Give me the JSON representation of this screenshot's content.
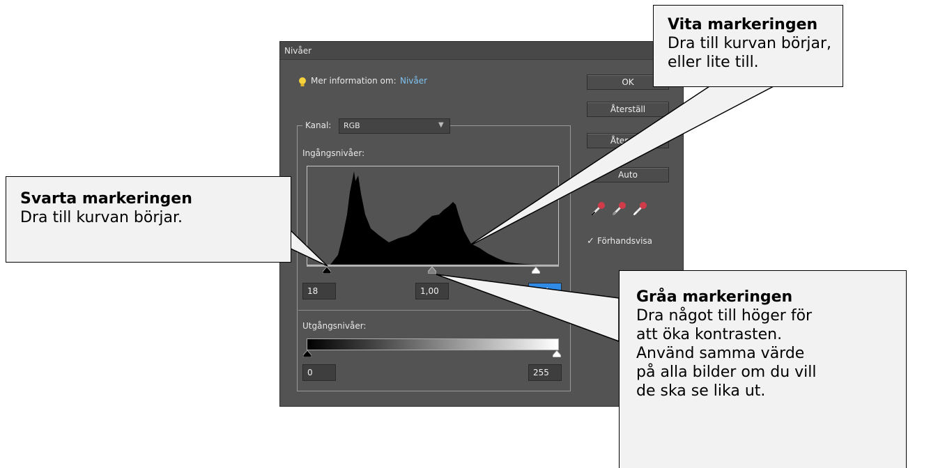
{
  "dialog": {
    "title": "Nivåer",
    "info_label": "Mer information om:",
    "info_link": "Nivåer",
    "channel_label": "Kanal:",
    "channel_value": "RGB",
    "input_levels_label": "Ingångsnivåer:",
    "input_black": "18",
    "input_gamma": "1,00",
    "input_white": "234",
    "output_levels_label": "Utgångsnivåer:",
    "output_black": "0",
    "output_white": "255",
    "buttons": {
      "ok": "OK",
      "reset": "Återställ",
      "restore": "Återställ",
      "auto": "Auto"
    },
    "preview_label": "Förhandsvisa",
    "preview_checked": true
  },
  "callouts": {
    "white": {
      "title": "Vita markeringen",
      "body1": "Dra till kurvan börjar,",
      "body2": "eller lite till."
    },
    "black": {
      "title": "Svarta markeringen",
      "body1": "Dra till kurvan börjar."
    },
    "gray": {
      "title": "Gråa markeringen",
      "body1": "Dra något till höger för",
      "body2": "att öka kontrasten.",
      "body3": "Använd samma värde",
      "body4": "på alla bilder om du vill",
      "body5": "de ska se lika ut."
    }
  },
  "colors": {
    "dialog_bg": "#535353",
    "selection": "#2f8be6",
    "link": "#7fc3f0",
    "eyedropper": "#d03b4a"
  },
  "icons": [
    "lightbulb-icon",
    "chevron-down-icon",
    "black-eyedropper-icon",
    "gray-eyedropper-icon",
    "white-eyedropper-icon",
    "checkbox-check-icon",
    "slider-handle-icon"
  ]
}
